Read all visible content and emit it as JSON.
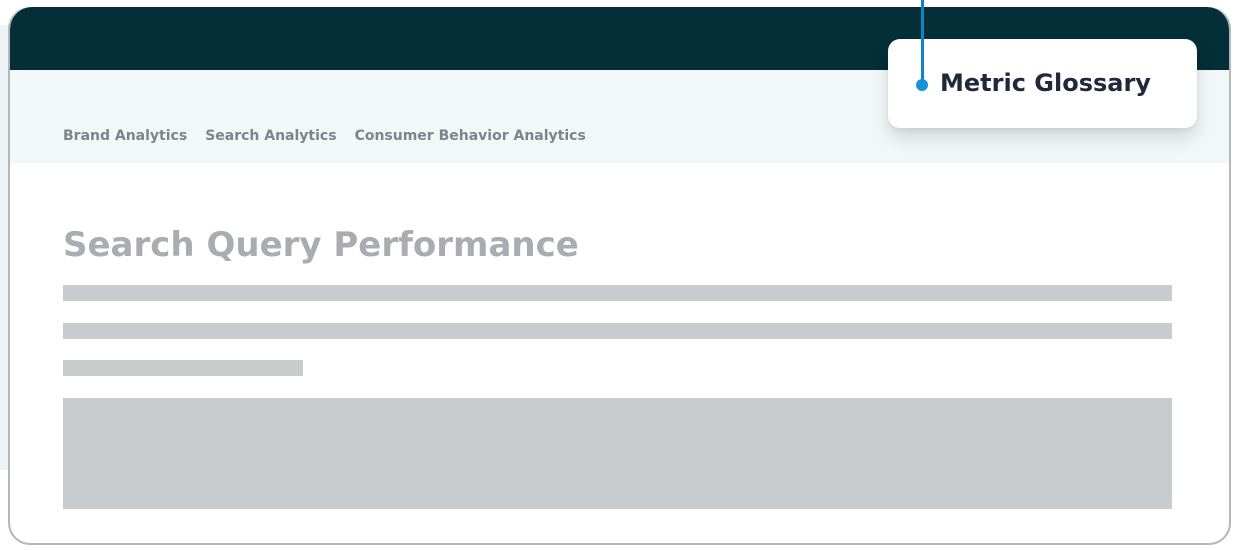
{
  "nav": {
    "items": [
      {
        "label": "Brand Analytics"
      },
      {
        "label": "Search Analytics"
      },
      {
        "label": "Consumer Behavior Analytics"
      }
    ]
  },
  "page": {
    "title": "Search Query Performance"
  },
  "callout": {
    "label": "Metric Glossary",
    "icon": "pointer-dot-icon",
    "accent_color": "#1592d8"
  },
  "colors": {
    "topbar": "#042f38",
    "nav_band": "#f2f7f8",
    "nav_text": "#7b858b",
    "placeholder": "#c9ccce",
    "title_text": "#a9adb2"
  }
}
